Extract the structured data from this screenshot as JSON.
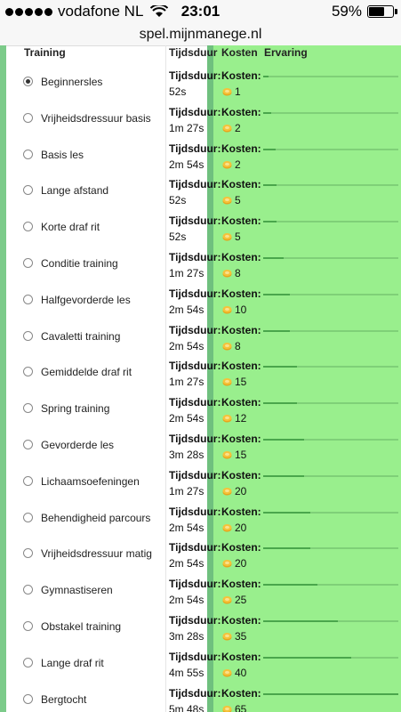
{
  "status": {
    "carrier": "vodafone NL",
    "time": "23:01",
    "battery": "59%"
  },
  "url": "spel.mijnmanege.nl",
  "headers": {
    "training": "Training",
    "duration": "Tijdsduur",
    "cost": "Kosten",
    "xp": "Ervaring"
  },
  "labels": {
    "duration": "Tijdsduur:",
    "cost": "Kosten:"
  },
  "colors": {
    "green_panel": "#99ef8d",
    "divider": "#6fc07e",
    "xp_fill": "#4aa64c",
    "coin": "#f2b225"
  },
  "icons": {
    "coin": "coin-icon",
    "radio": "radio-button"
  },
  "rows": [
    {
      "name": "Beginnersles",
      "duration": "52s",
      "cost": "1",
      "selected": true,
      "xp": 0.04
    },
    {
      "name": "Vrijheidsdressuur basis",
      "duration": "1m 27s",
      "cost": "2",
      "selected": false,
      "xp": 0.06
    },
    {
      "name": "Basis les",
      "duration": "2m 54s",
      "cost": "2",
      "selected": false,
      "xp": 0.09
    },
    {
      "name": "Lange afstand",
      "duration": "52s",
      "cost": "5",
      "selected": false,
      "xp": 0.1
    },
    {
      "name": "Korte draf rit",
      "duration": "52s",
      "cost": "5",
      "selected": false,
      "xp": 0.1
    },
    {
      "name": "Conditie training",
      "duration": "1m 27s",
      "cost": "8",
      "selected": false,
      "xp": 0.15
    },
    {
      "name": "Halfgevorderde les",
      "duration": "2m 54s",
      "cost": "10",
      "selected": false,
      "xp": 0.2
    },
    {
      "name": "Cavaletti training",
      "duration": "2m 54s",
      "cost": "8",
      "selected": false,
      "xp": 0.2
    },
    {
      "name": "Gemiddelde draf rit",
      "duration": "1m 27s",
      "cost": "15",
      "selected": false,
      "xp": 0.25
    },
    {
      "name": "Spring training",
      "duration": "2m 54s",
      "cost": "12",
      "selected": false,
      "xp": 0.25
    },
    {
      "name": "Gevorderde les",
      "duration": "3m 28s",
      "cost": "15",
      "selected": false,
      "xp": 0.3
    },
    {
      "name": "Lichaamsoefeningen",
      "duration": "1m 27s",
      "cost": "20",
      "selected": false,
      "xp": 0.3
    },
    {
      "name": "Behendigheid parcours",
      "duration": "2m 54s",
      "cost": "20",
      "selected": false,
      "xp": 0.35
    },
    {
      "name": "Vrijheidsdressuur matig",
      "duration": "2m 54s",
      "cost": "20",
      "selected": false,
      "xp": 0.35
    },
    {
      "name": "Gymnastiseren",
      "duration": "2m 54s",
      "cost": "25",
      "selected": false,
      "xp": 0.4
    },
    {
      "name": "Obstakel training",
      "duration": "3m 28s",
      "cost": "35",
      "selected": false,
      "xp": 0.55
    },
    {
      "name": "Lange draf rit",
      "duration": "4m 55s",
      "cost": "40",
      "selected": false,
      "xp": 0.65
    },
    {
      "name": "Bergtocht",
      "duration": "5m 48s",
      "cost": "65",
      "selected": false,
      "xp": 1.0
    }
  ]
}
